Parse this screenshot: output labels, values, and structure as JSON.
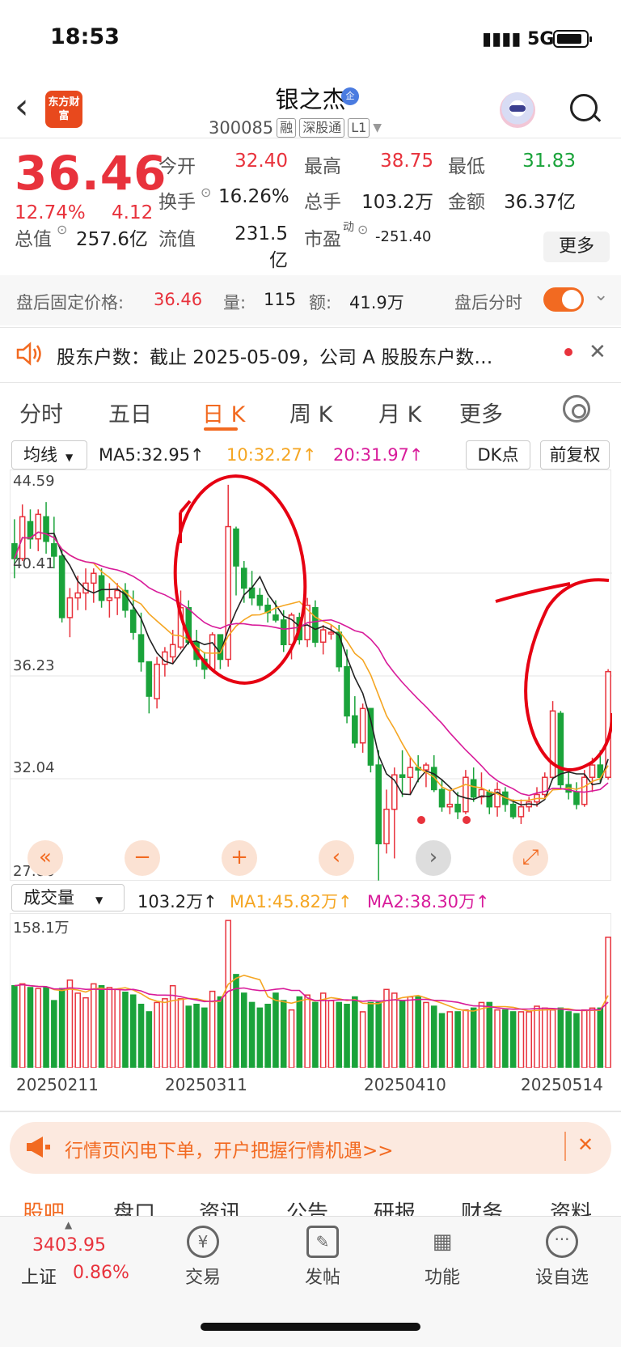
{
  "status_bar": {
    "time": "18:53",
    "network": "5G"
  },
  "header": {
    "stock_name": "银之杰",
    "badge": "企",
    "code": "300085",
    "tags": [
      "融",
      "深股通",
      "L1"
    ],
    "logo_text": "东方财富"
  },
  "quote": {
    "price": "36.46",
    "change_pct": "12.74%",
    "change": "4.12",
    "open_label": "今开",
    "open": "32.40",
    "high_label": "最高",
    "high": "38.75",
    "low_label": "最低",
    "low": "31.83",
    "turnover_label": "换手",
    "turnover": "16.26%",
    "volume_label": "总手",
    "volume": "103.2万",
    "amount_label": "金额",
    "amount": "36.37亿",
    "mktcap_label": "总值",
    "mktcap": "257.6亿",
    "float_label": "流值",
    "float": "231.5亿",
    "pe_label": "市盈",
    "pe_sup": "动",
    "pe": "-251.40",
    "more": "更多"
  },
  "after_hours": {
    "label": "盘后固定价格:",
    "price": "36.46",
    "vol_label": "量:",
    "vol": "115",
    "amt_label": "额:",
    "amt": "41.9万",
    "toggle_label": "盘后分时"
  },
  "notice": {
    "text": "股东户数：截止 2025-05-09，公司 A 股股东户数…"
  },
  "tabs": [
    "分时",
    "五日",
    "日 K",
    "周 K",
    "月 K",
    "更多"
  ],
  "indicators": {
    "ma_dropdown": "均线",
    "ma5": "MA5:32.95↑",
    "ma10": "10:32.27↑",
    "ma20": "20:31.97↑",
    "dk": "DK点",
    "adjust": "前复权",
    "vol_dropdown": "成交量",
    "vol_now": "103.2万↑",
    "vma1": "MA1:45.82万↑",
    "vma2": "MA2:38.30万↑",
    "vol_max": "158.1万"
  },
  "colors": {
    "up": "#e8323c",
    "down": "#1aa33a",
    "accent": "#f26a21",
    "ma5": "#222222",
    "ma10": "#f5a623",
    "ma20": "#d81b9a"
  },
  "chart_data": {
    "type": "candlestick",
    "y_ticks": [
      "44.59",
      "40.41",
      "36.23",
      "32.04",
      "27.86"
    ],
    "ylim": [
      27.86,
      44.59
    ],
    "x_ticks": [
      "20250211",
      "20250311",
      "20250410",
      "20250514"
    ],
    "candles": [
      [
        41.6,
        42.6,
        40.2,
        41.0
      ],
      [
        41.0,
        43.2,
        40.9,
        42.7
      ],
      [
        42.5,
        43.0,
        41.4,
        41.8
      ],
      [
        41.8,
        43.0,
        41.3,
        42.8
      ],
      [
        42.7,
        43.3,
        41.2,
        41.7
      ],
      [
        41.6,
        42.7,
        40.6,
        41.1
      ],
      [
        41.1,
        41.4,
        38.4,
        38.6
      ],
      [
        38.6,
        39.8,
        37.8,
        39.4
      ],
      [
        39.4,
        40.3,
        38.9,
        39.6
      ],
      [
        39.6,
        40.6,
        38.9,
        40.0
      ],
      [
        40.0,
        40.6,
        39.2,
        40.4
      ],
      [
        40.3,
        40.6,
        39.0,
        39.3
      ],
      [
        39.3,
        40.0,
        38.6,
        39.4
      ],
      [
        39.4,
        40.0,
        38.7,
        39.7
      ],
      [
        39.7,
        40.0,
        38.6,
        38.9
      ],
      [
        38.9,
        39.7,
        37.7,
        38.0
      ],
      [
        37.9,
        38.8,
        36.4,
        36.8
      ],
      [
        36.8,
        36.8,
        34.7,
        35.4
      ],
      [
        35.3,
        37.0,
        34.9,
        36.7
      ],
      [
        36.7,
        37.4,
        36.2,
        37.2
      ],
      [
        37.0,
        38.1,
        36.7,
        37.5
      ],
      [
        37.4,
        39.7,
        37.3,
        39.0
      ],
      [
        39.0,
        39.3,
        37.5,
        37.6
      ],
      [
        37.6,
        38.1,
        36.6,
        36.9
      ],
      [
        36.9,
        37.2,
        36.1,
        36.5
      ],
      [
        36.5,
        38.0,
        36.4,
        37.9
      ],
      [
        37.9,
        37.9,
        36.5,
        36.9
      ],
      [
        36.9,
        44.0,
        36.6,
        42.3
      ],
      [
        42.2,
        42.3,
        39.5,
        40.7
      ],
      [
        40.6,
        40.9,
        39.2,
        39.8
      ],
      [
        39.8,
        40.5,
        39.1,
        39.4
      ],
      [
        39.5,
        39.8,
        38.9,
        39.1
      ],
      [
        39.1,
        39.4,
        38.4,
        38.8
      ],
      [
        38.7,
        39.3,
        38.4,
        38.5
      ],
      [
        38.5,
        38.9,
        37.2,
        37.5
      ],
      [
        37.5,
        38.8,
        36.9,
        38.7
      ],
      [
        38.6,
        38.8,
        37.5,
        37.7
      ],
      [
        37.7,
        39.4,
        37.4,
        39.1
      ],
      [
        39.0,
        39.3,
        37.4,
        37.6
      ],
      [
        37.6,
        38.3,
        37.1,
        38.1
      ],
      [
        38.0,
        38.3,
        37.7,
        38.0
      ],
      [
        38.0,
        38.3,
        36.4,
        36.6
      ],
      [
        36.6,
        37.3,
        34.3,
        34.6
      ],
      [
        34.6,
        35.4,
        33.3,
        33.5
      ],
      [
        33.5,
        35.1,
        33.1,
        34.9
      ],
      [
        34.9,
        34.9,
        32.3,
        32.6
      ],
      [
        32.6,
        33.2,
        27.9,
        29.4
      ],
      [
        29.4,
        31.6,
        29.0,
        30.8
      ],
      [
        30.8,
        32.5,
        28.8,
        32.2
      ],
      [
        32.2,
        33.2,
        31.3,
        32.1
      ],
      [
        32.1,
        32.9,
        31.4,
        32.5
      ],
      [
        32.5,
        33.0,
        31.9,
        32.4
      ],
      [
        32.4,
        32.7,
        31.7,
        32.6
      ],
      [
        32.5,
        33.0,
        31.5,
        31.6
      ],
      [
        31.6,
        32.0,
        30.7,
        30.9
      ],
      [
        30.9,
        31.6,
        30.6,
        31.0
      ],
      [
        31.0,
        31.5,
        30.4,
        30.7
      ],
      [
        30.7,
        32.4,
        30.6,
        32.1
      ],
      [
        32.0,
        32.5,
        31.1,
        31.3
      ],
      [
        31.3,
        32.3,
        31.0,
        31.6
      ],
      [
        31.5,
        31.6,
        30.6,
        30.9
      ],
      [
        30.9,
        31.9,
        30.5,
        31.6
      ],
      [
        31.5,
        31.7,
        30.7,
        31.0
      ],
      [
        31.0,
        31.2,
        30.4,
        30.5
      ],
      [
        30.5,
        31.2,
        30.2,
        30.9
      ],
      [
        30.9,
        31.3,
        30.7,
        31.1
      ],
      [
        31.1,
        31.7,
        30.9,
        31.4
      ],
      [
        31.4,
        32.3,
        31.2,
        32.1
      ],
      [
        32.1,
        35.2,
        32.0,
        34.8
      ],
      [
        34.7,
        34.8,
        31.6,
        31.8
      ],
      [
        31.8,
        32.3,
        31.2,
        31.5
      ],
      [
        31.5,
        31.9,
        30.8,
        31.0
      ],
      [
        31.0,
        32.4,
        30.9,
        32.1
      ],
      [
        32.1,
        32.9,
        31.5,
        32.6
      ],
      [
        32.6,
        33.2,
        31.9,
        32.1
      ],
      [
        32.1,
        36.5,
        32.0,
        36.4
      ]
    ],
    "volumes": [
      88,
      90,
      86,
      85,
      86,
      72,
      85,
      94,
      80,
      75,
      90,
      88,
      86,
      84,
      81,
      78,
      68,
      60,
      70,
      74,
      88,
      74,
      66,
      68,
      64,
      82,
      76,
      158,
      100,
      80,
      70,
      64,
      68,
      80,
      72,
      62,
      76,
      78,
      70,
      80,
      72,
      70,
      68,
      76,
      60,
      70,
      70,
      84,
      80,
      72,
      76,
      76,
      70,
      66,
      58,
      60,
      60,
      62,
      64,
      70,
      70,
      62,
      62,
      60,
      60,
      60,
      66,
      64,
      62,
      64,
      60,
      58,
      62,
      64,
      64,
      140
    ],
    "vol_max": 158.1
  },
  "controls": {
    "icons": [
      "double-left",
      "zoom-out",
      "zoom-in",
      "prev",
      "next",
      "fullscreen"
    ]
  },
  "banner": {
    "text": "行情页闪电下单，开户把握行情机遇>>"
  },
  "sub_tabs": [
    "股吧",
    "盘口",
    "资讯",
    "公告",
    "研报",
    "财务",
    "资料"
  ],
  "bottom_nav": {
    "index_value": "3403.95",
    "index_name": "上证",
    "index_pct": "0.86%",
    "items": [
      "交易",
      "发帖",
      "功能",
      "设自选"
    ]
  }
}
